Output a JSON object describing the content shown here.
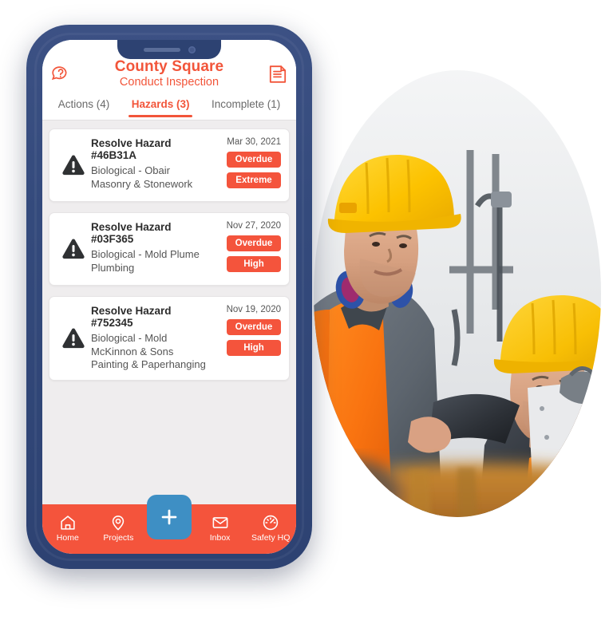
{
  "colors": {
    "brand_orange": "#F2553A",
    "badge_red": "#F4543C",
    "phone_navy": "#2d4272",
    "fab_blue": "#3E8FC4",
    "list_bg": "#efedee"
  },
  "phone": {
    "notch": {
      "speaker": "speaker-grille",
      "camera": "front-camera"
    }
  },
  "header": {
    "title": "County Square",
    "subtitle": "Conduct Inspection",
    "left_icon": "help-chat-icon",
    "right_icon": "document-list-icon"
  },
  "tabs": [
    {
      "label": "Actions (4)",
      "active": false
    },
    {
      "label": "Hazards (3)",
      "active": true
    },
    {
      "label": "Incomplete (1)",
      "active": false
    }
  ],
  "hazards": [
    {
      "icon": "warning-triangle-icon",
      "title": "Resolve Hazard #46B31A",
      "description": "Biological - Obair Masonry & Stonework",
      "date": "Mar 30, 2021",
      "badges": [
        "Overdue",
        "Extreme"
      ]
    },
    {
      "icon": "warning-triangle-icon",
      "title": "Resolve Hazard #03F365",
      "description": "Biological - Mold Plume Plumbing",
      "date": "Nov 27, 2020",
      "badges": [
        "Overdue",
        "High"
      ]
    },
    {
      "icon": "warning-triangle-icon",
      "title": "Resolve Hazard #752345",
      "description": "Biological - Mold McKinnon & Sons Painting & Paperhanging",
      "date": "Nov 19, 2020",
      "badges": [
        "Overdue",
        "High"
      ]
    }
  ],
  "bottom_nav": {
    "items": [
      {
        "label": "Home",
        "icon": "home-icon"
      },
      {
        "label": "Projects",
        "icon": "map-pin-icon"
      },
      {
        "label": "Inbox",
        "icon": "envelope-icon"
      },
      {
        "label": "Safety HQ",
        "icon": "speedometer-icon"
      }
    ],
    "fab": {
      "label": "+",
      "icon": "plus-icon"
    }
  },
  "photo": {
    "alt": "two-construction-workers-yellow-hardhats-orange-hivis-vests"
  }
}
